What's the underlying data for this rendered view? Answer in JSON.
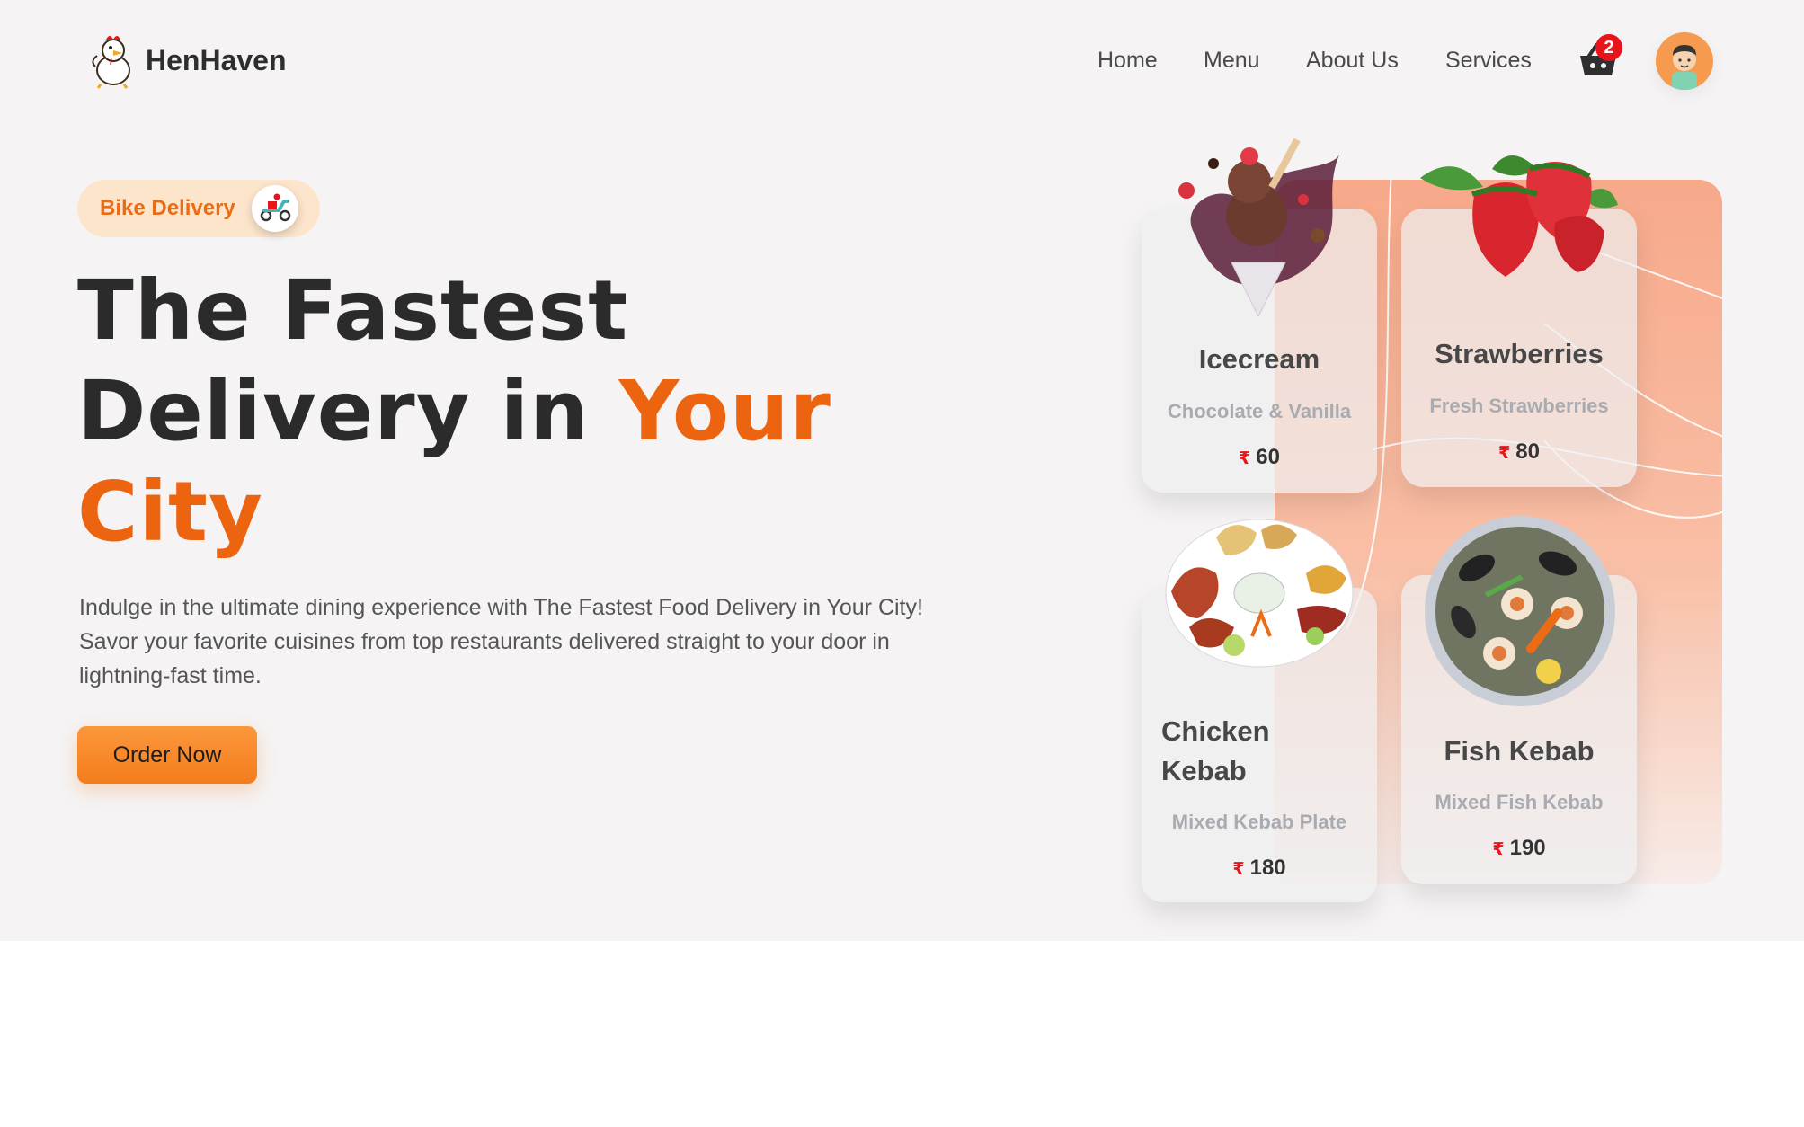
{
  "header": {
    "brand": "HenHaven",
    "nav": [
      "Home",
      "Menu",
      "About Us",
      "Services"
    ],
    "cart_count": "2"
  },
  "hero": {
    "badge": "Bike Delivery",
    "headline_line1": "The Fastest",
    "headline_line2": "Delivery in",
    "headline_accent1": "Your",
    "headline_accent2": "City",
    "description": "Indulge in the ultimate dining experience with The Fastest Food Delivery in Your City! Savor your favorite cuisines from top restaurants delivered straight to your door in lightning-fast time.",
    "cta": "Order Now"
  },
  "menu_cards": [
    {
      "name": "Icecream",
      "subtitle": "Chocolate & Vanilla",
      "currency": "₹",
      "price": "60"
    },
    {
      "name": "Strawberries",
      "subtitle": "Fresh Strawberries",
      "currency": "₹",
      "price": "80"
    },
    {
      "name": "Chicken Kebab",
      "subtitle": "Mixed Kebab Plate",
      "currency": "₹",
      "price": "180"
    },
    {
      "name": "Fish Kebab",
      "subtitle": "Mixed Fish Kebab",
      "currency": "₹",
      "price": "190"
    }
  ],
  "colors": {
    "accent": "#ec6410",
    "button": "#f47d1c",
    "badge_bg": "#fde5cc",
    "cart_badge": "#e8141c",
    "panel": "#f7a98a"
  }
}
